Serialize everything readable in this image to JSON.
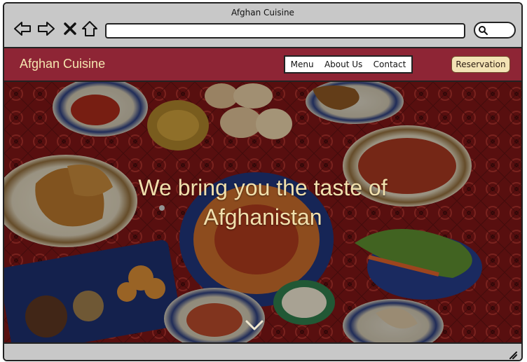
{
  "window": {
    "title": "Afghan Cuisine"
  },
  "toolbar": {
    "icons": [
      "back-arrow-icon",
      "forward-arrow-icon",
      "close-icon",
      "home-icon",
      "search-icon"
    ],
    "url": ""
  },
  "navbar": {
    "brand": "Afghan Cuisine",
    "menu": [
      {
        "label": "Menu"
      },
      {
        "label": "About Us"
      },
      {
        "label": "Contact"
      }
    ],
    "reservation_label": "Reservation"
  },
  "hero": {
    "heading_line1": "We bring you the taste of",
    "heading_line2": "Afghanistan",
    "scroll_icon": "chevron-down-icon"
  },
  "colors": {
    "navbar_bg": "#8e2535",
    "brand_text": "#f5e6b0",
    "reservation_bg": "#f3e3b5",
    "hero_text": "#f1e0ad",
    "chrome_bg": "#c8c8c8"
  }
}
